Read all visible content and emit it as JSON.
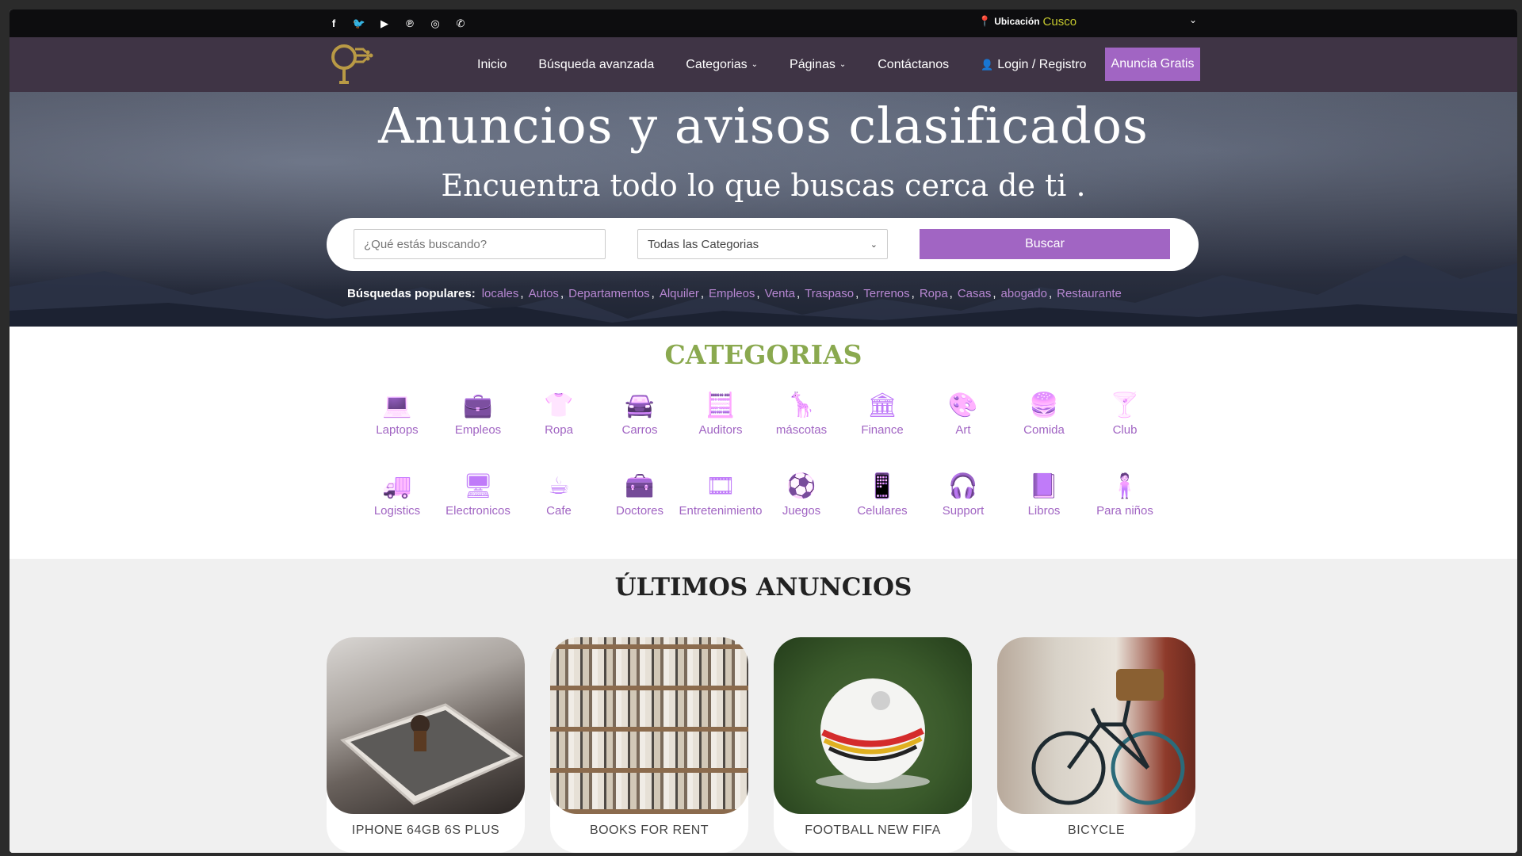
{
  "topbar": {
    "social": [
      {
        "name": "facebook-icon",
        "glyph": "f"
      },
      {
        "name": "twitter-icon",
        "glyph": "🐦"
      },
      {
        "name": "youtube-icon",
        "glyph": "▶"
      },
      {
        "name": "pinterest-icon",
        "glyph": "℗"
      },
      {
        "name": "instagram-icon",
        "glyph": "◎"
      },
      {
        "name": "whatsapp-icon",
        "glyph": "✆"
      }
    ],
    "location_label": "Ubicación",
    "location_city": "Cusco"
  },
  "nav": {
    "items": [
      {
        "label": "Inicio",
        "has_dropdown": false
      },
      {
        "label": "Búsqueda avanzada",
        "has_dropdown": false
      },
      {
        "label": "Categorias",
        "has_dropdown": true
      },
      {
        "label": "Páginas",
        "has_dropdown": true
      },
      {
        "label": "Contáctanos",
        "has_dropdown": false
      },
      {
        "label": "Login / Registro",
        "has_dropdown": false
      }
    ],
    "cta_label": "Anuncia Gratis"
  },
  "hero": {
    "title": "Anuncios y avisos clasificados",
    "subtitle": "Encuentra todo lo que buscas cerca de ti .",
    "search_placeholder": "¿Qué estás buscando?",
    "category_select": "Todas las Categorias",
    "search_button": "Buscar",
    "popular_label": "Búsquedas populares:",
    "popular_tags": [
      "locales",
      "Autos",
      "Departamentos",
      "Alquiler",
      "Empleos",
      "Venta",
      "Traspaso",
      "Terrenos",
      "Ropa",
      "Casas",
      "abogado",
      "Restaurante"
    ]
  },
  "categories": {
    "title": "CATEGORIAS",
    "items": [
      {
        "label": "Laptops",
        "icon": "laptop-icon",
        "glyph": "💻"
      },
      {
        "label": "Empleos",
        "icon": "briefcase-icon",
        "glyph": "💼"
      },
      {
        "label": "Ropa",
        "icon": "shirt-icon",
        "glyph": "👕"
      },
      {
        "label": "Carros",
        "icon": "car-icon",
        "glyph": "🚘"
      },
      {
        "label": "Auditors",
        "icon": "calculator-icon",
        "glyph": "🧮"
      },
      {
        "label": "máscotas",
        "icon": "pet-icon",
        "glyph": "🦒"
      },
      {
        "label": "Finance",
        "icon": "bank-icon",
        "glyph": "🏛"
      },
      {
        "label": "Art",
        "icon": "palette-icon",
        "glyph": "🎨"
      },
      {
        "label": "Comida",
        "icon": "burger-icon",
        "glyph": "🍔"
      },
      {
        "label": "Club",
        "icon": "cocktail-icon",
        "glyph": "🍸"
      },
      {
        "label": "Logistics",
        "icon": "truck-icon",
        "glyph": "🚚"
      },
      {
        "label": "Electronicos",
        "icon": "monitor-icon",
        "glyph": "🖥"
      },
      {
        "label": "Cafe",
        "icon": "coffee-icon",
        "glyph": "☕"
      },
      {
        "label": "Doctores",
        "icon": "medkit-icon",
        "glyph": "🧰"
      },
      {
        "label": "Entretenimiento",
        "icon": "film-icon",
        "glyph": "🎞"
      },
      {
        "label": "Juegos",
        "icon": "ball-icon",
        "glyph": "⚽"
      },
      {
        "label": "Celulares",
        "icon": "phone-icon",
        "glyph": "📱"
      },
      {
        "label": "Support",
        "icon": "headset-icon",
        "glyph": "🎧"
      },
      {
        "label": "Libros",
        "icon": "book-icon",
        "glyph": "📘"
      },
      {
        "label": "Para niños",
        "icon": "child-icon",
        "glyph": "🧍"
      }
    ]
  },
  "latest": {
    "title": "ÚLTIMOS ANUNCIOS",
    "cards": [
      {
        "title": "IPHONE 64GB 6S PLUS"
      },
      {
        "title": "BOOKS FOR RENT"
      },
      {
        "title": "FOOTBALL NEW FIFA"
      },
      {
        "title": "BICYCLE"
      }
    ]
  },
  "colors": {
    "accent": "#a165c3",
    "nav_bg": "#3f3445",
    "category_title": "#8aa94f",
    "location_city": "#c5c82e"
  }
}
